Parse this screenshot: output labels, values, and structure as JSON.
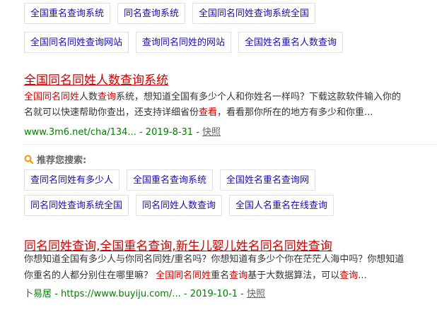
{
  "top_chips_row1": [
    "全国重名查询系统",
    "同名查询系统",
    "全国同名同姓查询系统全国"
  ],
  "top_chips_row2": [
    "全国同名同姓查询网站",
    "查询同名同姓的网站",
    "全国姓名重名人数查询"
  ],
  "result1": {
    "title": "全国同名同姓人数查询系统",
    "snippet_line1": [
      "全国同名同姓",
      "人数",
      "查询",
      "系统，想知道全国有多少个人和你姓名一样吗？下载这款软件输入你的"
    ],
    "snippet_line2": [
      "名就可以快速帮助你查出，还支持详细省份",
      "查看",
      "，看看那你所在的地方有多少和你重..."
    ],
    "url": "www.3m6.net/cha/134...",
    "date": " - 2019-8-31 - ",
    "snapshot": "快照"
  },
  "related": {
    "header": "推荐您搜索:",
    "row1": [
      "查同名同姓有多少人",
      "全国重名查询系统",
      "全国姓名重名查询网"
    ],
    "row2": [
      "同名同姓查询系统全国",
      "同名同姓人数查询",
      "全国人名重名在线查询"
    ]
  },
  "result2": {
    "title": "同名同姓查询,全国重名查询,新生儿婴儿姓名同名同姓查询",
    "snippet_line1": "你想知道全国有多少人与你同名同姓/重名吗？你想知道有多少个你在茫茫人海中吗？你想知道",
    "snippet_line2": [
      "你重名的人都分别住在哪里嘛？ ",
      "全国同名同姓",
      "重名",
      "查询",
      "基于大数据算法，可以",
      "查询",
      "..."
    ],
    "site": "卜易居",
    "url": " - https://www.buyiju.com/...",
    "date": " - 2019-10-1 - ",
    "snapshot": "快照"
  },
  "colors": {
    "link": "#1a0dab",
    "highlight": "#cc0000",
    "url": "#008000"
  }
}
